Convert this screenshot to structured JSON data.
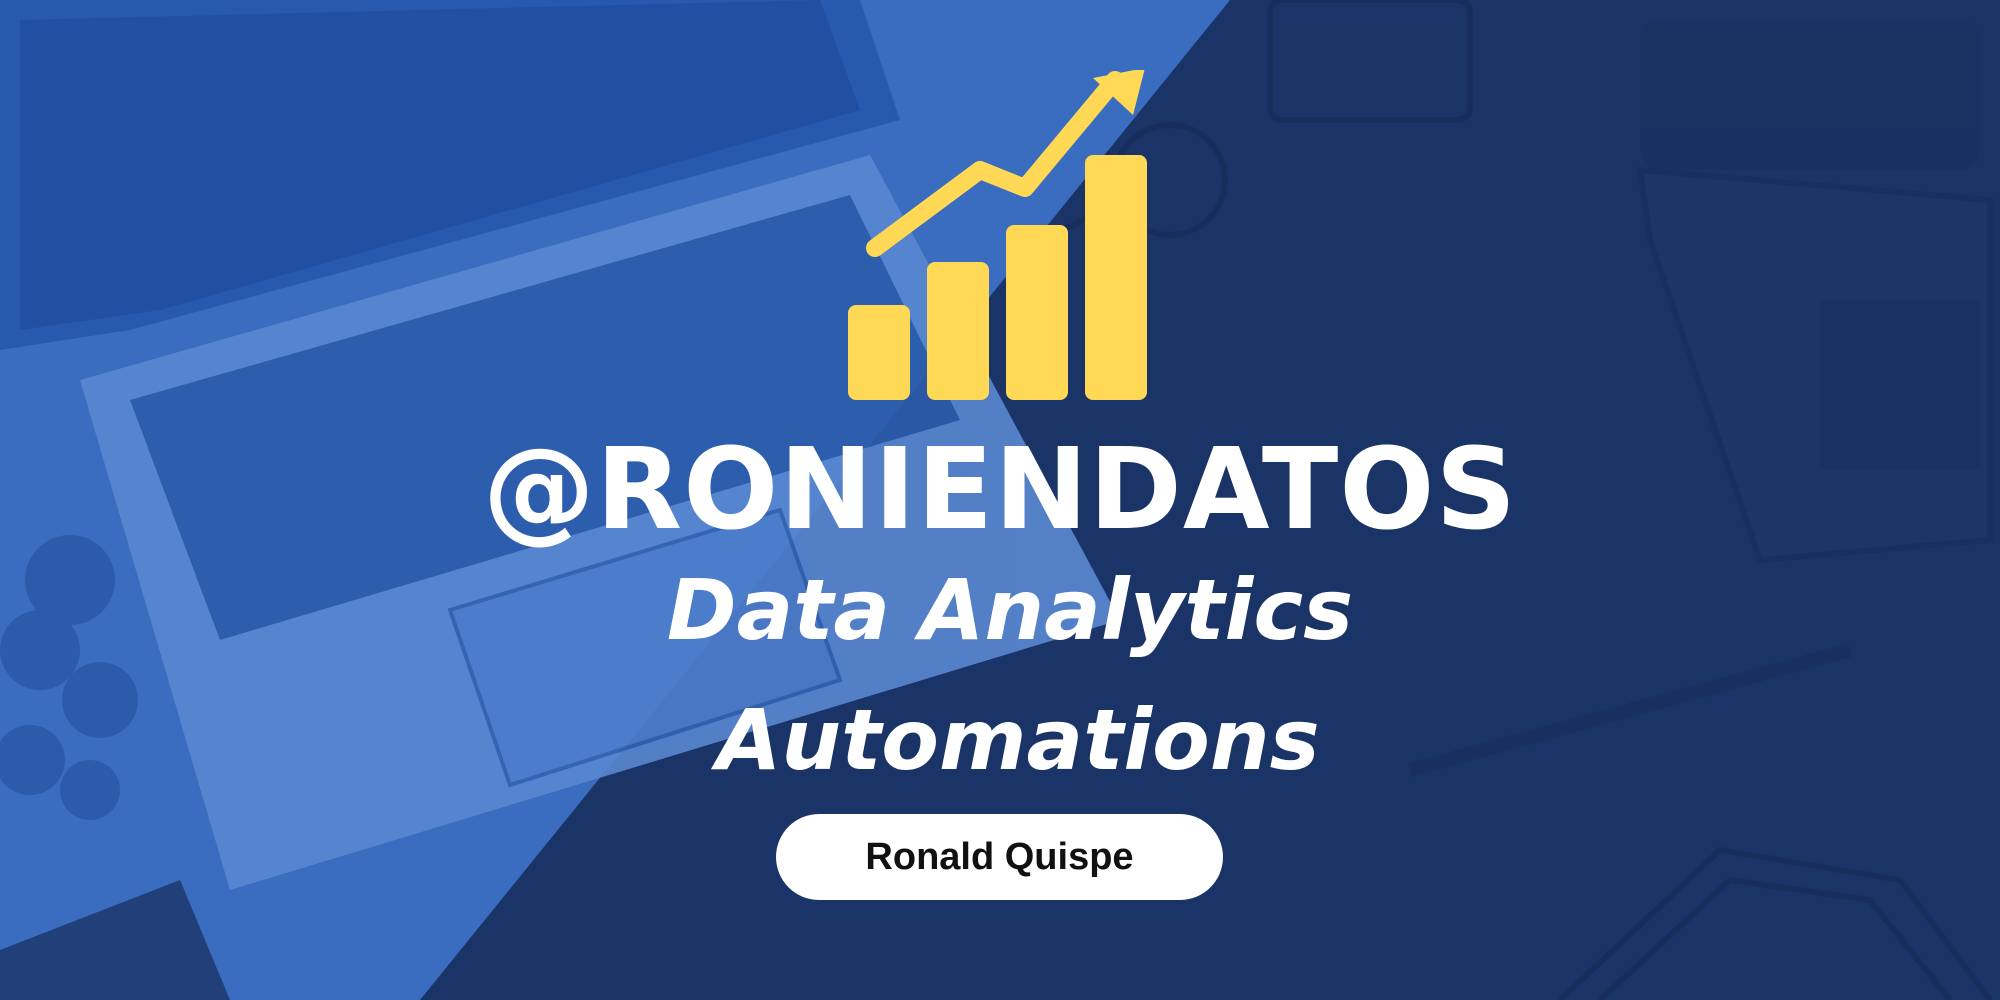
{
  "banner": {
    "handle": "@RONIENDATOS",
    "line1": "Data Analytics",
    "line2": "Automations",
    "name_button": "Ronald Quispe"
  },
  "colors": {
    "light_blue": "#3a6cc0",
    "dark_navy": "#1b3467",
    "accent_yellow": "#ffd955",
    "text": "#ffffff"
  },
  "icons": [
    "bar-chart-icon",
    "trend-arrow-icon"
  ]
}
